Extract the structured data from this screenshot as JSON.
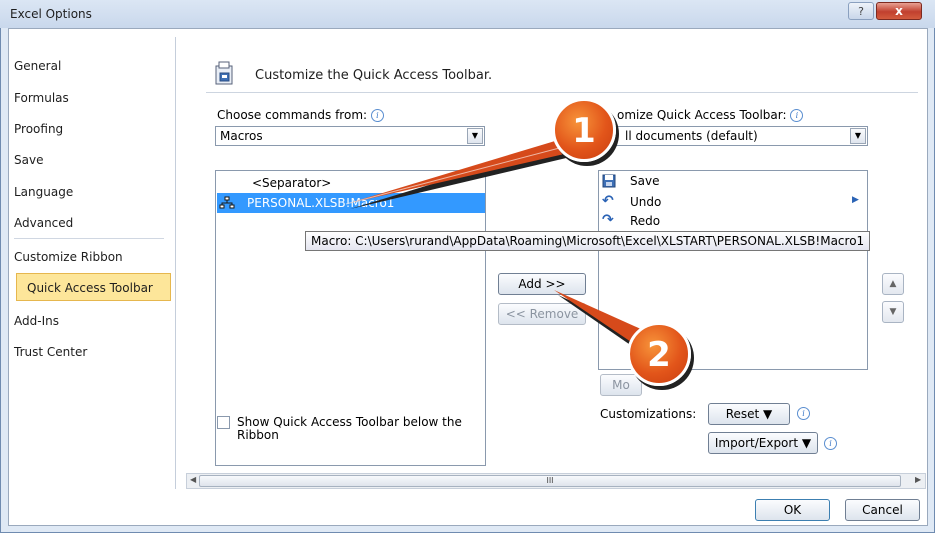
{
  "window": {
    "title": "Excel Options",
    "help_label": "?",
    "close_label": "x"
  },
  "nav": [
    "General",
    "Formulas",
    "Proofing",
    "Save",
    "Language",
    "Advanced",
    "Customize Ribbon",
    "Quick Access Toolbar",
    "Add-Ins",
    "Trust Center"
  ],
  "header": {
    "title": "Customize the Quick Access Toolbar."
  },
  "commands": {
    "label": "Choose commands from:",
    "value": "Macros",
    "items": [
      "<Separator>",
      "PERSONAL.XLSB!Macro1"
    ]
  },
  "toolbar_list": {
    "label": "omize Quick Access Toolbar:",
    "value": "ll documents (default)",
    "items": [
      "Save",
      "Undo",
      "Redo"
    ]
  },
  "tooltip": "Macro: C:\\Users\\rurand\\AppData\\Roaming\\Microsoft\\Excel\\XLSTART\\PERSONAL.XLSB!Macro1",
  "buttons": {
    "add": "Add >>",
    "remove": "<< Remove",
    "modify": "Mo",
    "reset": "Reset ▼",
    "import_export": "Import/Export ▼",
    "ok": "OK",
    "cancel": "Cancel"
  },
  "customizations_label": "Customizations:",
  "show_below": "Show Quick Access Toolbar below the Ribbon",
  "scroll_grip": "III",
  "callouts": [
    "1",
    "2"
  ],
  "colors": {
    "selection": "#3399ff",
    "nav_selected": "#fde69a",
    "callout": "#e2551a"
  }
}
